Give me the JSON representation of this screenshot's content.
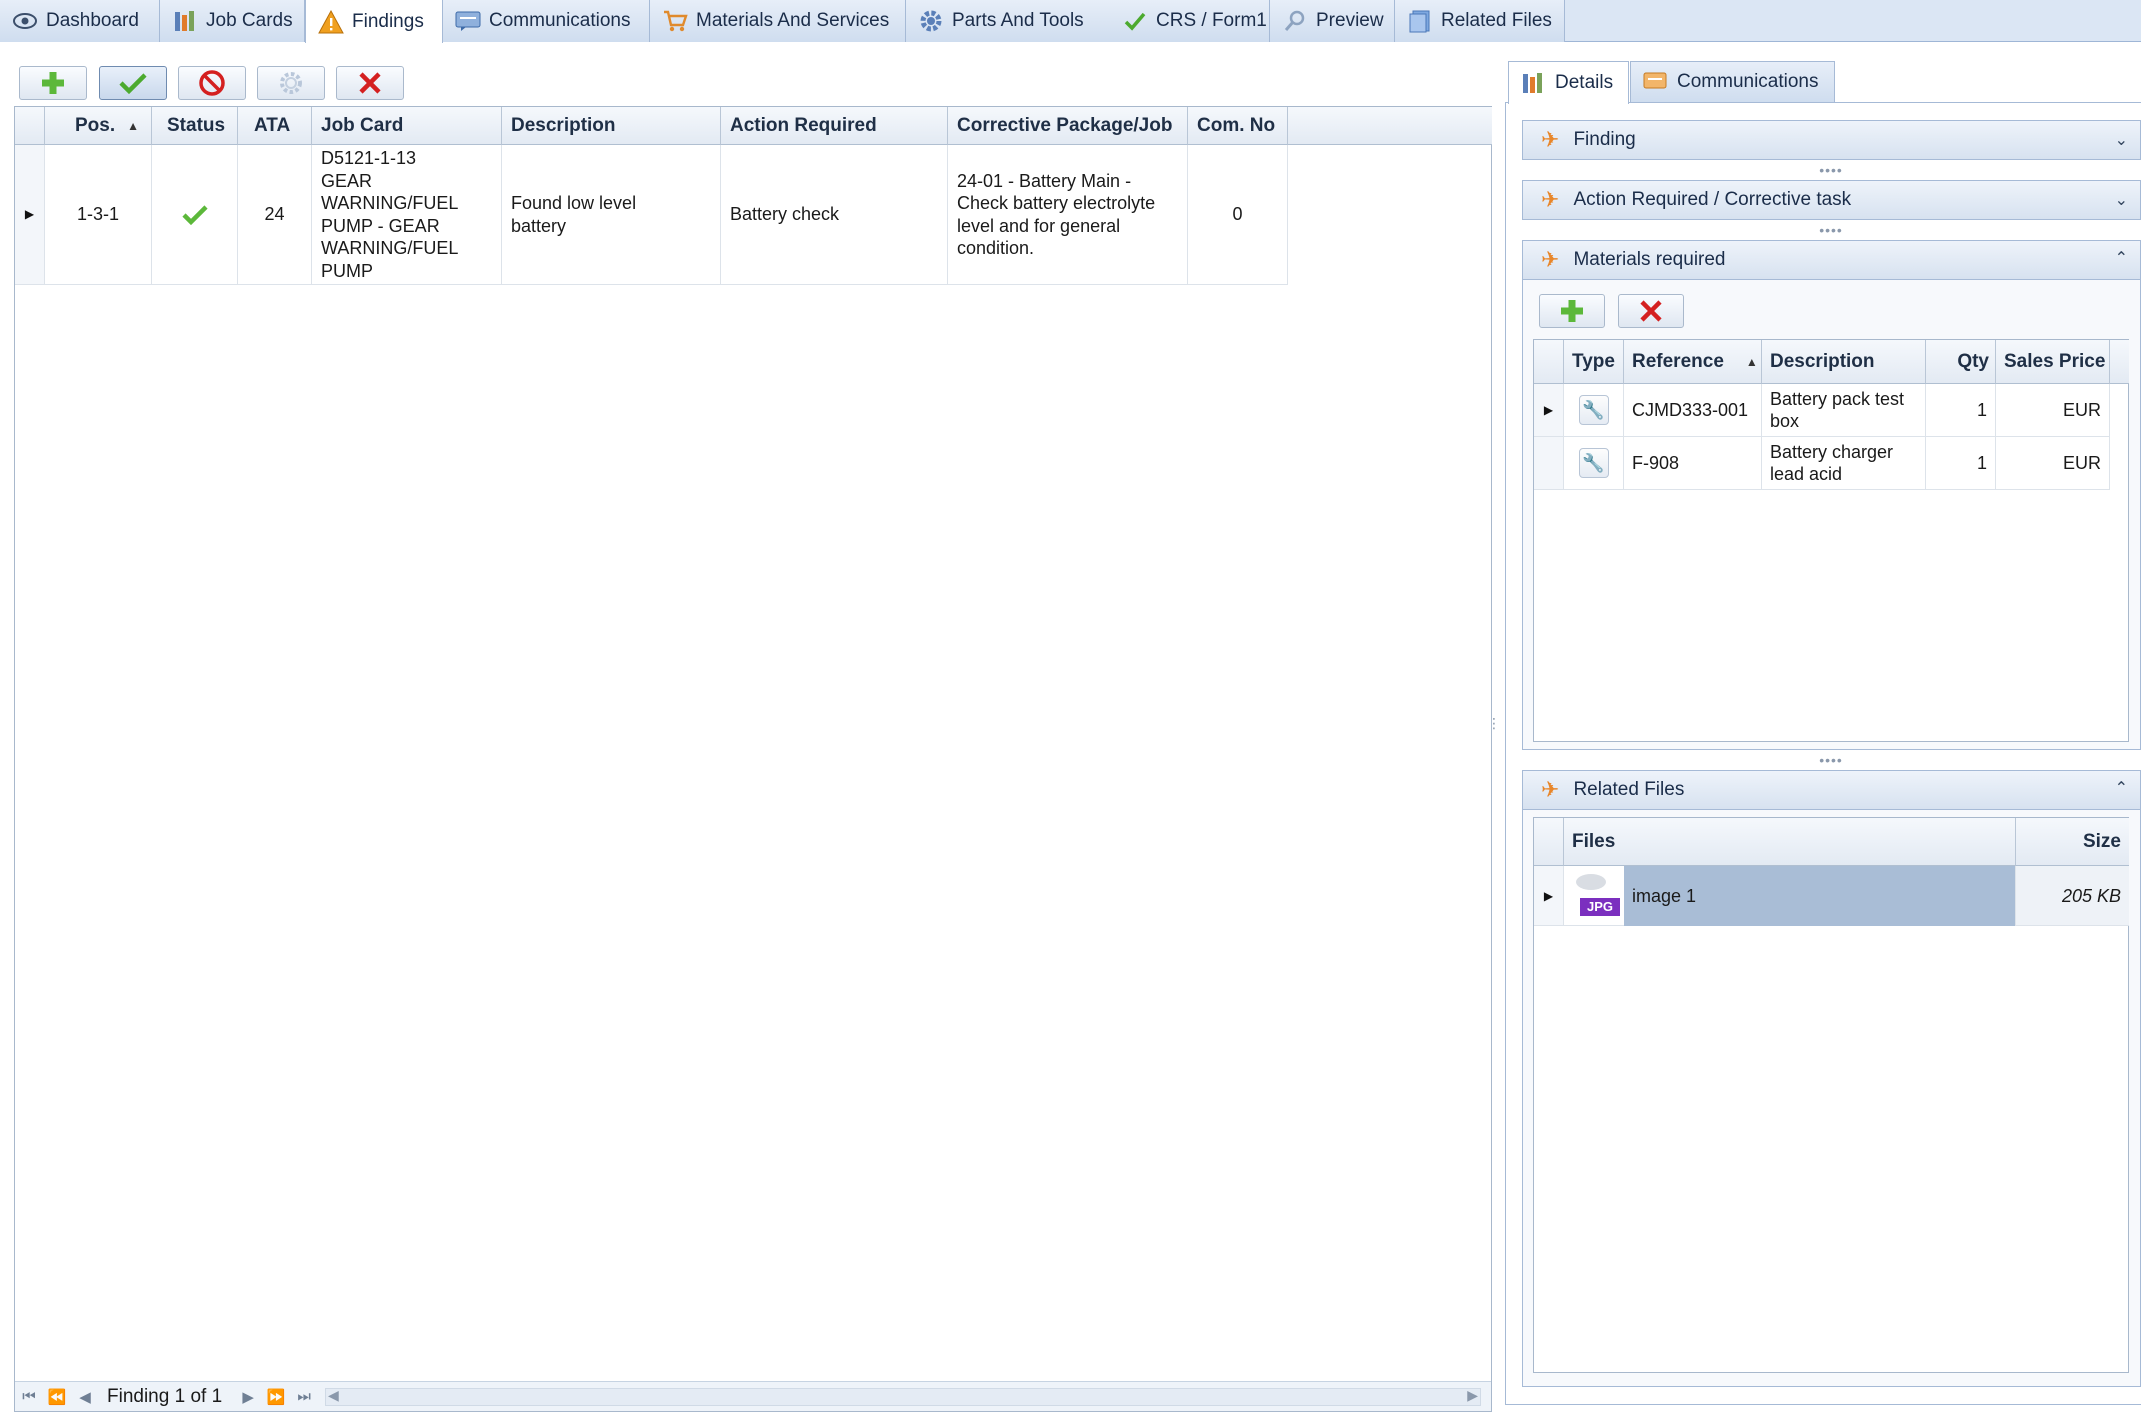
{
  "tabs": [
    {
      "label": "Dashboard",
      "icon": "eye-icon"
    },
    {
      "label": "Job Cards",
      "icon": "job-cards-icon"
    },
    {
      "label": "Findings",
      "icon": "warning-icon"
    },
    {
      "label": "Communications",
      "icon": "communications-icon"
    },
    {
      "label": "Materials And Services",
      "icon": "cart-icon"
    },
    {
      "label": "Parts And Tools",
      "icon": "gear-icon"
    },
    {
      "label": "CRS / Form1",
      "icon": "checkmark-icon"
    },
    {
      "label": "Preview",
      "icon": "magnifier-icon"
    },
    {
      "label": "Related Files",
      "icon": "files-icon"
    }
  ],
  "active_tab": "Findings",
  "toolbar": {
    "buttons": [
      "add-icon",
      "approve-icon",
      "cancel-icon",
      "settings-icon",
      "delete-icon"
    ]
  },
  "grid": {
    "columns": [
      "Pos.",
      "Status",
      "ATA",
      "Job Card",
      "Description",
      "Action Required",
      "Corrective Package/Job",
      "Com. No"
    ],
    "rows": [
      {
        "pos": "1-3-1",
        "status": "approved",
        "ata": "24",
        "job_card": "D5121-1-13 GEAR WARNING/FUEL PUMP - GEAR WARNING/FUEL PUMP",
        "description": "Found low level battery",
        "action_required": "Battery check",
        "corrective": "24-01 - Battery Main - Check battery electrolyte level and for general condition.",
        "com_no": "0"
      }
    ],
    "footer": "Finding 1 of 1"
  },
  "right_panel": {
    "tabs": [
      "Details",
      "Communications"
    ],
    "sections": {
      "finding": "Finding",
      "action": "Action Required / Corrective task",
      "materials": "Materials required",
      "files": "Related Files"
    },
    "materials": {
      "columns": [
        "Type",
        "Reference",
        "Description",
        "Qty",
        "Sales Price"
      ],
      "rows": [
        {
          "type": "wrench-icon",
          "reference": "CJMD333-001",
          "description": "Battery pack test box",
          "qty": "1",
          "price": "EUR"
        },
        {
          "type": "wrench-icon",
          "reference": "F-908",
          "description": "Battery charger lead acid",
          "qty": "1",
          "price": "EUR"
        }
      ]
    },
    "related_files": {
      "columns": [
        "Files",
        "Size"
      ],
      "rows": [
        {
          "name": "image 1",
          "size": "205 KB",
          "type": "JPG"
        }
      ]
    }
  },
  "colors": {
    "tab_bg": "#dbe6f4",
    "accent_orange": "#e8862a",
    "selected_row": "#a9bdd6",
    "jpg_badge": "#7b2fbf"
  }
}
